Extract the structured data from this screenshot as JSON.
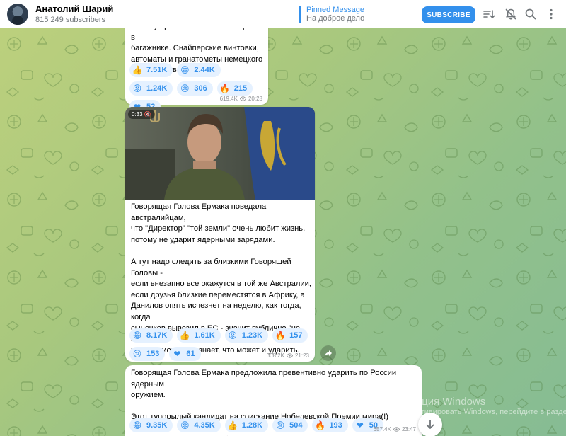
{
  "header": {
    "channel_name": "Анатолий Шарий",
    "subscribers": "815 249 subscribers",
    "pinned_title": "Pinned Message",
    "pinned_text": "На доброе дело",
    "subscribe_label": "SUBSCRIBE",
    "icons": [
      "sort-icon",
      "bell-muted-icon",
      "search-icon",
      "more-icon"
    ]
  },
  "messages": [
    {
      "text": "Вот эту прелесть везли в ЕС прямо в\nбагажнике. Снайперские винтовки,\nавтоматы и гранатометы немецкого\nпроизводства.",
      "reactions": [
        {
          "icon": "thumbs-up",
          "count": "7.51K"
        },
        {
          "icon": "grinning-face",
          "count": "2.44K"
        },
        {
          "icon": "angry-face",
          "count": "1.24K"
        },
        {
          "icon": "crying-face",
          "count": "306"
        },
        {
          "icon": "fire",
          "count": "215"
        },
        {
          "icon": "heart",
          "count": "52"
        }
      ],
      "views": "619.4K",
      "time": "20:28"
    },
    {
      "video_duration": "0:33",
      "text": "Говорящая Голова Ермака поведала австралийцам,\nчто \"Директор\" \"той земли\" очень любит жизнь,\nпотому не ударит ядерными зарядами.\n\nА тут надо следить за близкими Говорящей Головы -\nесли внезапно все окажутся в той же Австралии,\nесли друзья близкие переместятся в Африку, а\nДанилов опять исчезнет на неделю, как тогда, когда\nсыночков вывозил в ЕС - значит публично \"не верю\",\nно на самом деле знает, что может и ударить.\n\nГоворящая Голова такой пафосной стала, Ермак ей\nуже совсем злые вещи говорить позволяет.",
      "reactions": [
        {
          "icon": "grinning-face",
          "count": "8.17K"
        },
        {
          "icon": "thumbs-up",
          "count": "1.61K"
        },
        {
          "icon": "angry-face",
          "count": "1.23K"
        },
        {
          "icon": "fire",
          "count": "157"
        },
        {
          "icon": "crying-face",
          "count": "153"
        },
        {
          "icon": "heart",
          "count": "61"
        }
      ],
      "views": "608.2K",
      "time": "21:23"
    },
    {
      "text": "Говорящая Голова Ермака предложила превентивно ударить по России ядерным\nоружием.\n\nЭтот тупорылый кандидат на соискание Нобелевской Премии мира(!) понимает,\nчто Украина... несколько близковато, скажем так, от России находится?",
      "reactions": [
        {
          "icon": "grinning-face",
          "count": "9.35K"
        },
        {
          "icon": "angry-face",
          "count": "4.35K"
        },
        {
          "icon": "thumbs-up",
          "count": "1.28K"
        },
        {
          "icon": "crying-face",
          "count": "504"
        },
        {
          "icon": "fire",
          "count": "193"
        },
        {
          "icon": "heart",
          "count": "50"
        }
      ],
      "views": "657.4K",
      "time": "23:47"
    }
  ],
  "os_watermark": {
    "line1": "Активация Windows",
    "line2": "Чтобы активировать Windows, перейдите в раздел"
  }
}
